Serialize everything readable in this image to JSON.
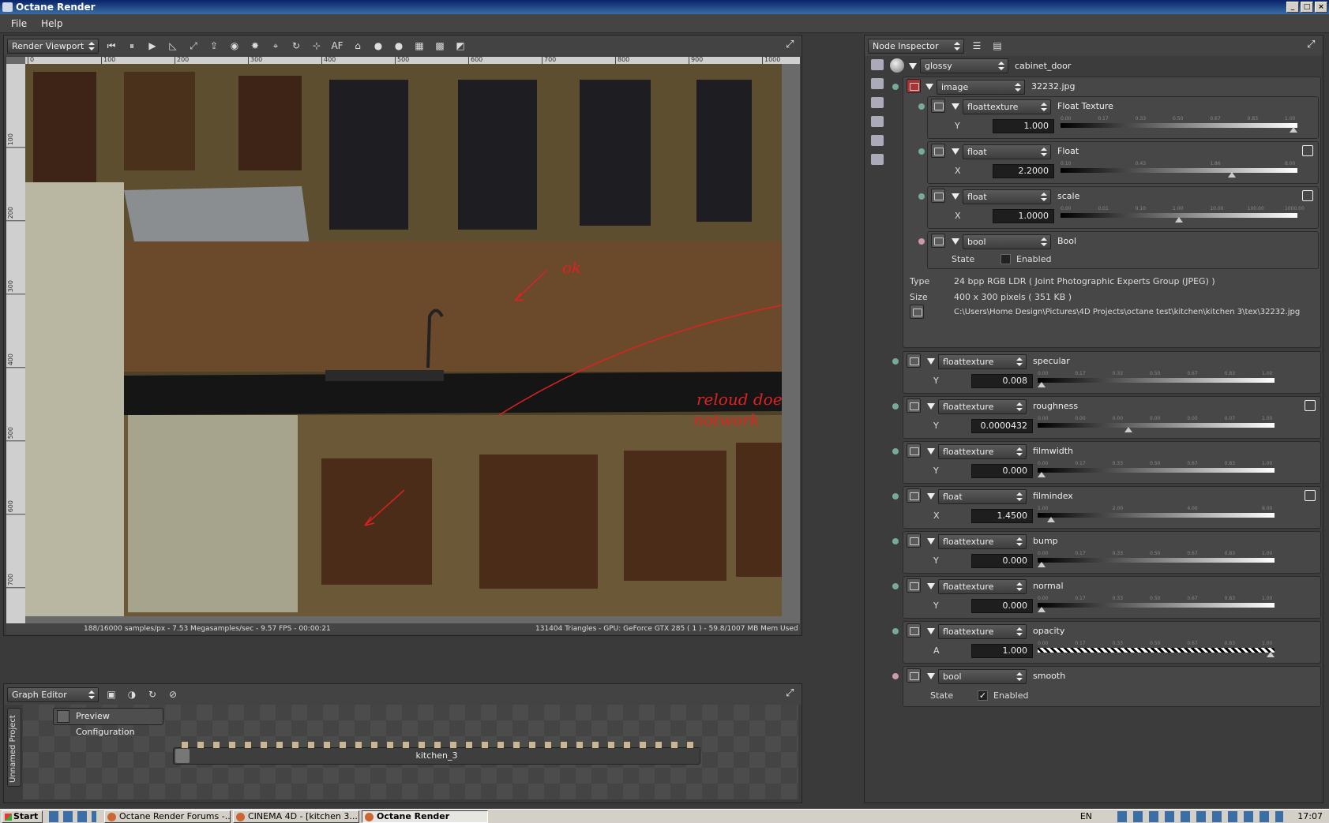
{
  "window": {
    "title": "Octane Render"
  },
  "menu": [
    "File",
    "Help"
  ],
  "viewport": {
    "combo": "Render Viewport",
    "af_label": "AF",
    "ruler_h": [
      "0",
      "100",
      "200",
      "300",
      "400",
      "500",
      "600",
      "700",
      "800",
      "900",
      "1000"
    ],
    "ruler_v": [
      "100",
      "200",
      "300",
      "400",
      "500",
      "600",
      "700"
    ],
    "status_left": "188/16000 samples/px - 7.53 Megasamples/sec - 9.57 FPS - 00:00:21",
    "status_right": "131404 Triangles - GPU: GeForce GTX 285 ( 1 ) - 59.8/1007 MB Mem Used",
    "annotations": [
      "ok",
      "reloud does",
      "notwork",
      "?"
    ]
  },
  "graph": {
    "combo": "Graph Editor",
    "side_label": "Unnamed Project",
    "preview_button": "Preview Configuration",
    "node_label": "kitchen_3"
  },
  "inspector": {
    "combo": "Node Inspector",
    "root": {
      "type": "glossy",
      "name": "cabinet_door"
    },
    "image_node": {
      "type": "image",
      "name": "32232.jpg"
    },
    "image_sub": [
      {
        "type": "floattexture",
        "name": "Float Texture",
        "axis": "Y",
        "value": "1.000",
        "ticks": [
          "0.00",
          "0.17",
          "0.33",
          "0.50",
          "0.67",
          "0.83",
          "1.00"
        ],
        "pos": 1.0
      },
      {
        "type": "float",
        "name": "Float",
        "axis": "X",
        "value": "2.2000",
        "ticks": [
          "0.10",
          "0.43",
          "1.86",
          "8.00"
        ],
        "pos": 0.73
      },
      {
        "type": "float",
        "name": "scale",
        "axis": "X",
        "value": "1.0000",
        "ticks": [
          "0.00",
          "0.01",
          "0.10",
          "1.00",
          "10.00",
          "100.00",
          "1000.00"
        ],
        "pos": 0.5
      }
    ],
    "bool_node": {
      "type": "bool",
      "name": "Bool",
      "state_label": "State",
      "enabled_label": "Enabled"
    },
    "info": {
      "type_label": "Type",
      "type_value": "24 bpp RGB LDR ( Joint Photographic Experts Group (JPEG) )",
      "size_label": "Size",
      "size_value": "400 x 300 pixels ( 351 KB )",
      "path": "C:\\Users\\Home Design\\Pictures\\4D Projects\\octane test\\kitchen\\kitchen 3\\tex\\32232.jpg"
    },
    "params": [
      {
        "type": "floattexture",
        "name": "specular",
        "axis": "Y",
        "value": "0.008",
        "ticks": [
          "0.00",
          "0.17",
          "0.33",
          "0.50",
          "0.67",
          "0.83",
          "1.00"
        ],
        "pos": 0.0
      },
      {
        "type": "floattexture",
        "name": "roughness",
        "axis": "Y",
        "value": "0.0000432",
        "ticks": [
          "0.00",
          "0.00",
          "0.00",
          "0.00",
          "0.00",
          "0.07",
          "1.00"
        ],
        "pos": 0.38
      },
      {
        "type": "floattexture",
        "name": "filmwidth",
        "axis": "Y",
        "value": "0.000",
        "ticks": [
          "0.00",
          "0.17",
          "0.33",
          "0.50",
          "0.67",
          "0.83",
          "1.00"
        ],
        "pos": 0.0
      },
      {
        "type": "float",
        "name": "filmindex",
        "axis": "X",
        "value": "1.4500",
        "ticks": [
          "1.00",
          "2.00",
          "4.00",
          "8.00"
        ],
        "pos": 0.04
      },
      {
        "type": "floattexture",
        "name": "bump",
        "axis": "Y",
        "value": "0.000",
        "ticks": [
          "0.00",
          "0.17",
          "0.33",
          "0.50",
          "0.67",
          "0.83",
          "1.00"
        ],
        "pos": 0.0
      },
      {
        "type": "floattexture",
        "name": "normal",
        "axis": "Y",
        "value": "0.000",
        "ticks": [
          "0.00",
          "0.17",
          "0.33",
          "0.50",
          "0.67",
          "0.83",
          "1.00"
        ],
        "pos": 0.0
      },
      {
        "type": "floattexture",
        "name": "opacity",
        "axis": "A",
        "value": "1.000",
        "ticks": [
          "0.00",
          "0.17",
          "0.33",
          "0.50",
          "0.67",
          "0.83",
          "1.00"
        ],
        "pos": 1.0
      }
    ],
    "smooth": {
      "type": "bool",
      "name": "smooth",
      "state_label": "State",
      "enabled_label": "Enabled"
    }
  },
  "taskbar": {
    "start": "Start",
    "tasks": [
      "Octane Render Forums -...",
      "CINEMA 4D - [kitchen 3....",
      "Octane Render"
    ],
    "lang": "EN",
    "time": "17:07"
  }
}
